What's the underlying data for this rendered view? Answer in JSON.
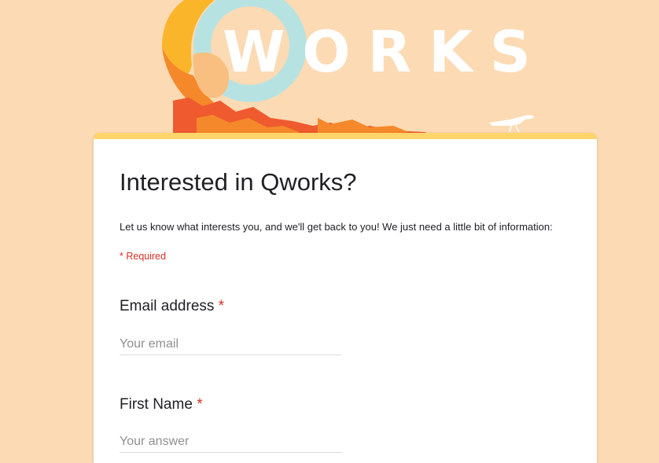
{
  "header": {
    "logo_text": "WORKS",
    "brand_colors": {
      "background": "#fcdab3",
      "accent_bar": "#fed56a",
      "logo_yellow": "#fbb52b",
      "logo_orange": "#f5882a",
      "logo_red": "#ef5a2f",
      "logo_teal": "#b6e3e2"
    }
  },
  "form": {
    "title": "Interested in Qworks?",
    "description": "Let us know what interests you, and we'll get back to you! We just need a little bit of information:",
    "required_note": "* Required",
    "questions": [
      {
        "label": "Email address",
        "required_mark": "*",
        "placeholder": "Your email"
      },
      {
        "label": "First Name",
        "required_mark": "*",
        "placeholder": "Your answer"
      }
    ]
  }
}
